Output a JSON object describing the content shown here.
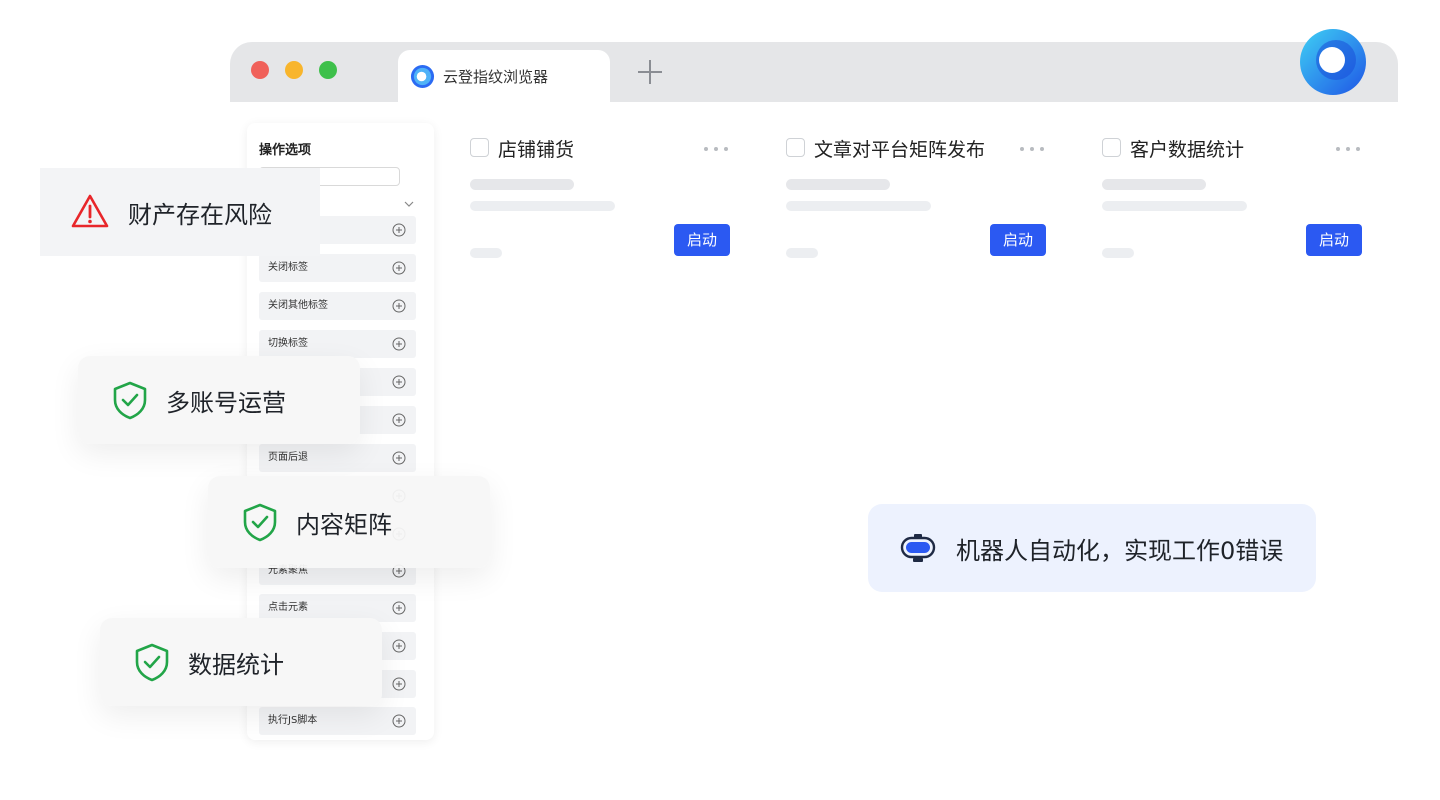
{
  "browser": {
    "tab_title": "云登指纹浏览器",
    "colors": {
      "close": "#f0615a",
      "minimize": "#f8b52c",
      "maximize": "#3ec04b",
      "accent": "#2b59f2"
    }
  },
  "sidebar": {
    "title": "操作选项",
    "search_placeholder": "",
    "items": [
      {
        "label": ""
      },
      {
        "label": "关闭标签"
      },
      {
        "label": "关闭其他标签"
      },
      {
        "label": "切换标签"
      },
      {
        "label": ""
      },
      {
        "label": ""
      },
      {
        "label": "页面后退"
      },
      {
        "label": ""
      },
      {
        "label": ""
      },
      {
        "label": "元素聚焦"
      },
      {
        "label": "点击元素"
      },
      {
        "label": ""
      },
      {
        "label": ""
      },
      {
        "label": "执行JS脚本"
      }
    ]
  },
  "cards": [
    {
      "title": "店铺铺货",
      "button": "启动"
    },
    {
      "title": "文章对平台矩阵发布",
      "button": "启动"
    },
    {
      "title": "客户数据统计",
      "button": "启动"
    }
  ],
  "badges": {
    "risk": "财产存在风险",
    "multi_account": "多账号运营",
    "content_matrix": "内容矩阵",
    "data_stats": "数据统计"
  },
  "robot": {
    "text": "机器人自动化，实现工作0错误"
  }
}
